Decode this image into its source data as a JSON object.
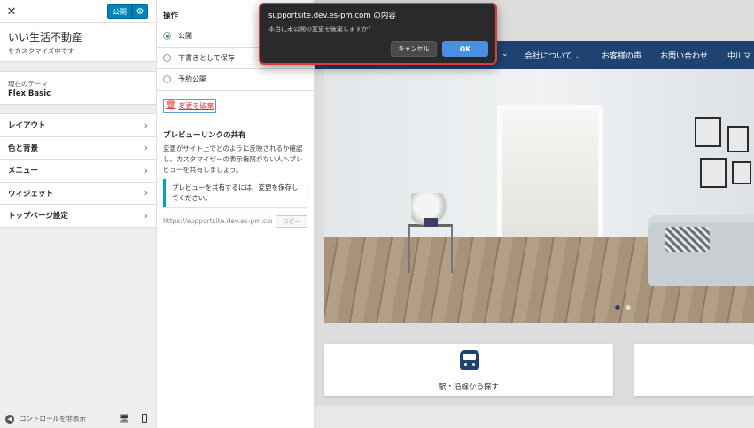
{
  "sidebar": {
    "close_glyph": "✕",
    "publish_label": "公開",
    "gear_glyph": "⚙",
    "site_title": "いい生活不動産",
    "site_subtitle": "をカスタマイズ中です",
    "theme_label": "現在のテーマ",
    "theme_name": "Flex Basic",
    "menu": [
      {
        "label": "レイアウト"
      },
      {
        "label": "色と背景"
      },
      {
        "label": "メニュー"
      },
      {
        "label": "ウィジェット"
      },
      {
        "label": "トップページ設定"
      }
    ],
    "footer_label": "コントロールを非表示",
    "collapse_glyph": "◀",
    "desktop_glyph": "🖥"
  },
  "publish_panel": {
    "title": "操作",
    "options": [
      {
        "label": "公開",
        "checked": true
      },
      {
        "label": "下書きとして保存",
        "checked": false
      },
      {
        "label": "予約公開",
        "checked": false
      }
    ],
    "discard_label": "変更を破棄",
    "trash_glyph": "🗑",
    "share_title": "プレビューリンクの共有",
    "share_desc": "変更がサイト上でどのように反映されるか確認し、カスタマイザーの表示権限がない人へプレビューを共有しましょう。",
    "share_notice": "プレビューを共有するには、変更を保存してください。",
    "share_url": "https://supportsite.dev.es-pm.com",
    "copy_label": "コピー"
  },
  "preview": {
    "nav": [
      {
        "label": "⌄"
      },
      {
        "label": "会社について ⌄"
      },
      {
        "label": "お客様の声"
      },
      {
        "label": "お問い合わせ"
      },
      {
        "label": "中川マ"
      }
    ],
    "card_1_label": "駅・沿線から探す",
    "slider_dots": 2,
    "active_dot": 0,
    "nav_color": "#1e4373"
  },
  "dialog": {
    "title": "supportsite.dev.es-pm.com の内容",
    "message": "本当に未公開の変更を破棄しますか？",
    "cancel_label": "キャンセル",
    "ok_label": "OK",
    "highlight_color": "#e03b3b"
  }
}
